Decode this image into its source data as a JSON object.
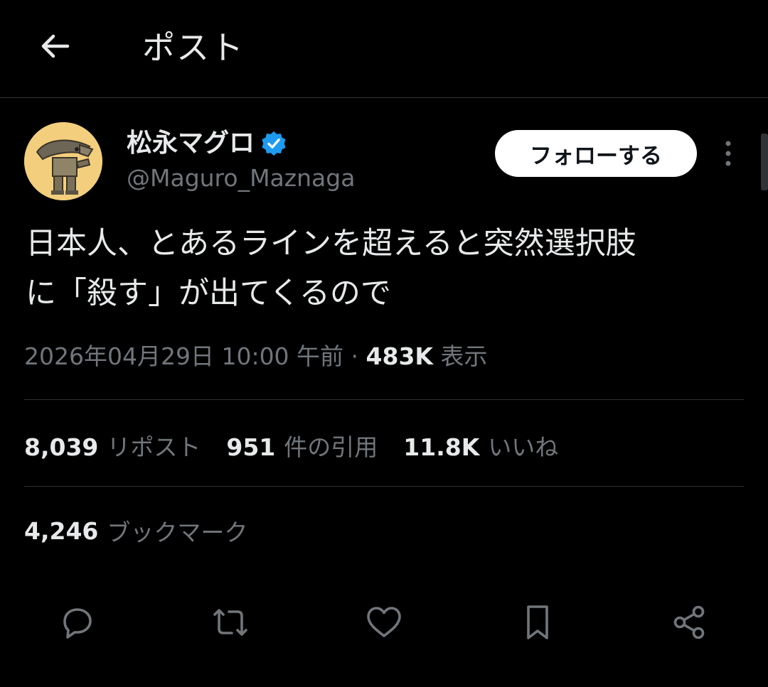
{
  "header": {
    "back_icon": "arrow-left-icon",
    "title": "ポスト"
  },
  "author": {
    "name": "松永マグロ",
    "handle": "@Maguro_Maznaga",
    "verified_icon": "verified-badge-icon",
    "verified_color": "#1d9bf0"
  },
  "follow_button": {
    "label": "フォローする"
  },
  "more_icon": "more-vertical-icon",
  "tweet": {
    "text_line1": "日本人、とあるラインを超えると突然選択肢",
    "text_line2": "に「殺す」が出てくるので"
  },
  "meta": {
    "timestamp": "2026年04月29日 10:00 午前",
    "separator": "·",
    "views_count": "483K",
    "views_label": "表示"
  },
  "stats": {
    "reposts": {
      "count": "8,039",
      "label": "リポスト"
    },
    "quotes": {
      "count": "951",
      "label": "件の引用"
    },
    "likes": {
      "count": "11.8K",
      "label": "いいね"
    },
    "bookmarks": {
      "count": "4,246",
      "label": "ブックマーク"
    }
  },
  "actions": [
    "reply-icon",
    "repost-icon",
    "like-icon",
    "bookmark-icon",
    "share-icon"
  ],
  "colors": {
    "background": "#000000",
    "text_primary": "#e7e9ea",
    "text_secondary": "#71767b",
    "divider": "#2f3336",
    "follow_bg": "#ffffff"
  }
}
